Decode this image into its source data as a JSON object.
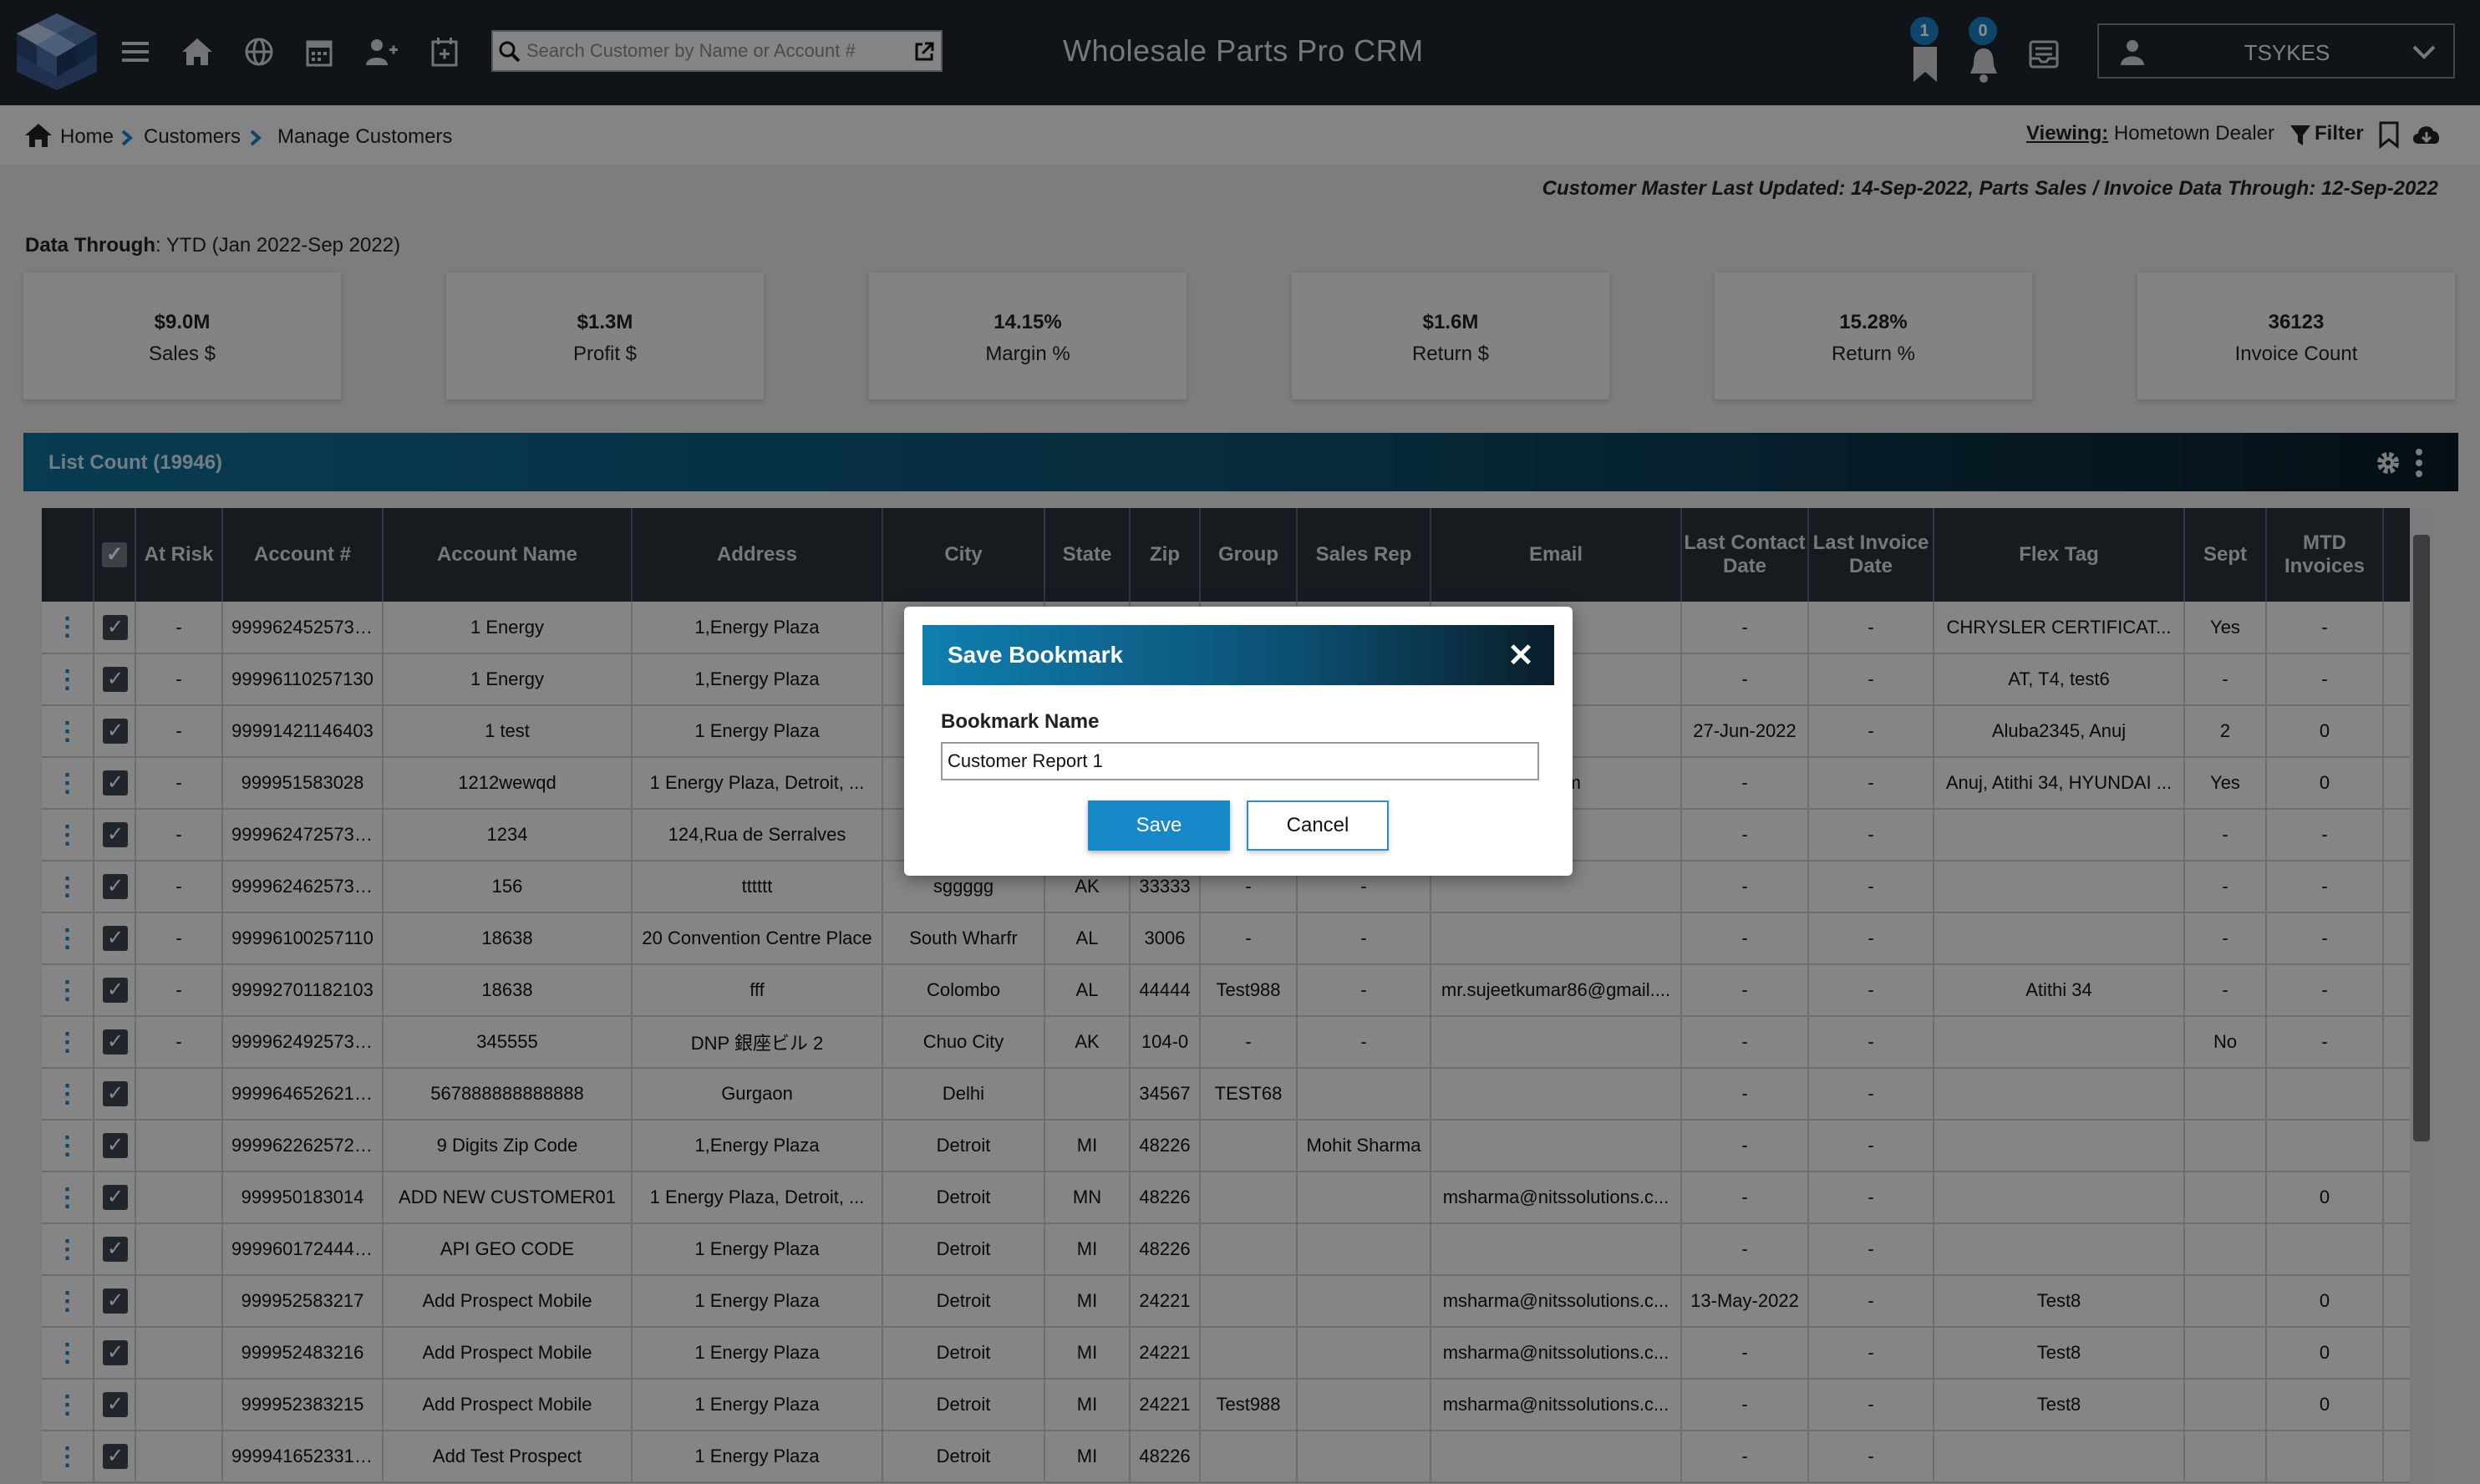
{
  "header": {
    "app_title": "Wholesale Parts Pro CRM",
    "search_placeholder": "Search Customer by Name or Account #",
    "bookmark_badge": "1",
    "notification_badge": "0",
    "username": "TSYKES",
    "nav_icons": [
      "menu-icon",
      "home-icon",
      "globe-icon",
      "calendar-icon",
      "add-user-icon",
      "calendar-add-icon"
    ]
  },
  "breadcrumb": {
    "home": "Home",
    "customers": "Customers",
    "manage": "Manage Customers"
  },
  "viewing": {
    "label": "Viewing:",
    "value": "Hometown Dealer",
    "filter": "Filter"
  },
  "updated_text": "Customer Master Last Updated: 14-Sep-2022, Parts Sales / Invoice Data Through: 12-Sep-2022",
  "data_through": {
    "label": "Data Through",
    "value": ": YTD (Jan 2022-Sep 2022)"
  },
  "kpis": [
    {
      "value": "$9.0M",
      "label": "Sales $"
    },
    {
      "value": "$1.3M",
      "label": "Profit $"
    },
    {
      "value": "14.15%",
      "label": "Margin %"
    },
    {
      "value": "$1.6M",
      "label": "Return $"
    },
    {
      "value": "15.28%",
      "label": "Return %"
    },
    {
      "value": "36123",
      "label": "Invoice Count"
    }
  ],
  "list": {
    "title": "List Count (19946)"
  },
  "table": {
    "columns": [
      "",
      "",
      "At Risk",
      "Account #",
      "Account Name",
      "Address",
      "City",
      "State",
      "Zip",
      "Group",
      "Sales Rep",
      "Email",
      "Last Contact Date",
      "Last Invoice Date",
      "Flex Tag",
      "Sept",
      "MTD Invoices",
      "MT"
    ],
    "rows": [
      [
        "-",
        "99996245257337",
        "1 Energy",
        "1,Energy Plaza",
        "",
        "",
        "",
        "",
        "",
        "",
        "-",
        "-",
        "CHRYSLER CERTIFICAT...",
        "Yes",
        "-"
      ],
      [
        "-",
        "99996110257130",
        "1 Energy",
        "1,Energy Plaza",
        "",
        "",
        "",
        "",
        "",
        "",
        "-",
        "-",
        "AT, T4, test6",
        "-",
        "-"
      ],
      [
        "-",
        "99991421146403",
        "1 test",
        "1 Energy Plaza",
        "",
        "",
        "",
        "",
        "",
        "",
        "27-Jun-2022",
        "-",
        "Aluba2345, Anuj",
        "2",
        "0"
      ],
      [
        "-",
        "999951583028",
        "1212wewqd",
        "1 Energy Plaza, Detroit, ...",
        "",
        "",
        "",
        "",
        "",
        "e.com",
        "-",
        "-",
        "Anuj, Atithi 34, HYUNDAI ...",
        "Yes",
        "0"
      ],
      [
        "-",
        "99996247257340",
        "1234",
        "124,Rua de Serralves",
        "",
        "",
        "",
        "",
        "",
        "",
        "-",
        "-",
        "",
        "-",
        "-"
      ],
      [
        "-",
        "99996246257339",
        "156",
        "tttttt",
        "sggggg",
        "AK",
        "33333",
        "-",
        "-",
        "",
        "-",
        "-",
        "",
        "-",
        "-"
      ],
      [
        "-",
        "99996100257110",
        "18638",
        "20 Convention Centre Place",
        "South Wharfr",
        "AL",
        "3006",
        "-",
        "-",
        "",
        "-",
        "-",
        "",
        "-",
        "-"
      ],
      [
        "-",
        "99992701182103",
        "18638",
        "fff",
        "Colombo",
        "AL",
        "44444",
        "Test988",
        "-",
        "mr.sujeetkumar86@gmail....",
        "-",
        "-",
        "Atithi 34",
        "-",
        "-"
      ],
      [
        "-",
        "99996249257342",
        "345555",
        "DNP 銀座ビル 2",
        "Chuo City",
        "AK",
        "104-0",
        "-",
        "-",
        "",
        "-",
        "-",
        "",
        "No",
        "-"
      ],
      [
        "",
        "99996465262149",
        "567888888888888",
        "Gurgaon",
        "Delhi",
        "",
        "34567",
        "TEST68",
        "",
        "",
        "-",
        "-",
        "",
        "",
        ""
      ],
      [
        "",
        "99996226257292",
        "9 Digits Zip Code",
        "1,Energy Plaza",
        "Detroit",
        "MI",
        "48226",
        "",
        "Mohit Sharma",
        "",
        "-",
        "-",
        "",
        "",
        ""
      ],
      [
        "",
        "999950183014",
        "ADD NEW CUSTOMER01",
        "1 Energy Plaza, Detroit, ...",
        "Detroit",
        "MN",
        "48226",
        "",
        "",
        "msharma@nitssolutions.c...",
        "-",
        "-",
        "",
        "",
        "0"
      ],
      [
        "",
        "99996017244405",
        "API GEO CODE",
        "1 Energy Plaza",
        "Detroit",
        "MI",
        "48226",
        "",
        "",
        "",
        "-",
        "-",
        "",
        "",
        ""
      ],
      [
        "",
        "999952583217",
        "Add Prospect Mobile",
        "1 Energy Plaza",
        "Detroit",
        "MI",
        "24221",
        "",
        "",
        "msharma@nitssolutions.c...",
        "13-May-2022",
        "-",
        "Test8",
        "",
        "0"
      ],
      [
        "",
        "999952483216",
        "Add Prospect Mobile",
        "1 Energy Plaza",
        "Detroit",
        "MI",
        "24221",
        "",
        "",
        "msharma@nitssolutions.c...",
        "-",
        "-",
        "Test8",
        "",
        "0"
      ],
      [
        "",
        "999952383215",
        "Add Prospect Mobile",
        "1 Energy Plaza",
        "Detroit",
        "MI",
        "24221",
        "Test988",
        "",
        "msharma@nitssolutions.c...",
        "-",
        "-",
        "Test8",
        "",
        "0"
      ],
      [
        "",
        "99994165233187",
        "Add Test Prospect",
        "1 Energy Plaza",
        "Detroit",
        "MI",
        "48226",
        "",
        "",
        "",
        "-",
        "-",
        "",
        "",
        ""
      ]
    ]
  },
  "modal": {
    "title": "Save Bookmark",
    "field_label": "Bookmark Name",
    "field_value": "Customer Report 1",
    "save_label": "Save",
    "cancel_label": "Cancel"
  }
}
